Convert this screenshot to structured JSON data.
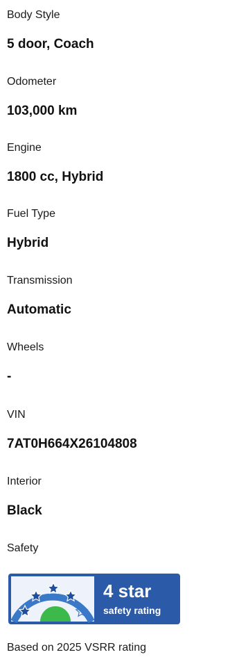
{
  "specs": [
    {
      "label": "Body Style",
      "value": "5 door, Coach"
    },
    {
      "label": "Odometer",
      "value": "103,000 km"
    },
    {
      "label": "Engine",
      "value": "1800 cc, Hybrid"
    },
    {
      "label": "Fuel Type",
      "value": "Hybrid"
    },
    {
      "label": "Transmission",
      "value": "Automatic"
    },
    {
      "label": "Wheels",
      "value": "-"
    },
    {
      "label": "VIN",
      "value": "7AT0H664X26104808"
    },
    {
      "label": "Interior",
      "value": "Black"
    }
  ],
  "safety": {
    "label": "Safety",
    "rating_text": "4 star",
    "rating_subtext": "safety rating",
    "stars_filled": 4,
    "stars_total": 5,
    "footnote": "Based on 2025 VSRR rating",
    "colors": {
      "badge": "#2a5aa8",
      "arc": "#3a78c8",
      "green": "#3db84a",
      "star_fill": "#1f4e9e",
      "star_outline": "#ffffff"
    }
  }
}
